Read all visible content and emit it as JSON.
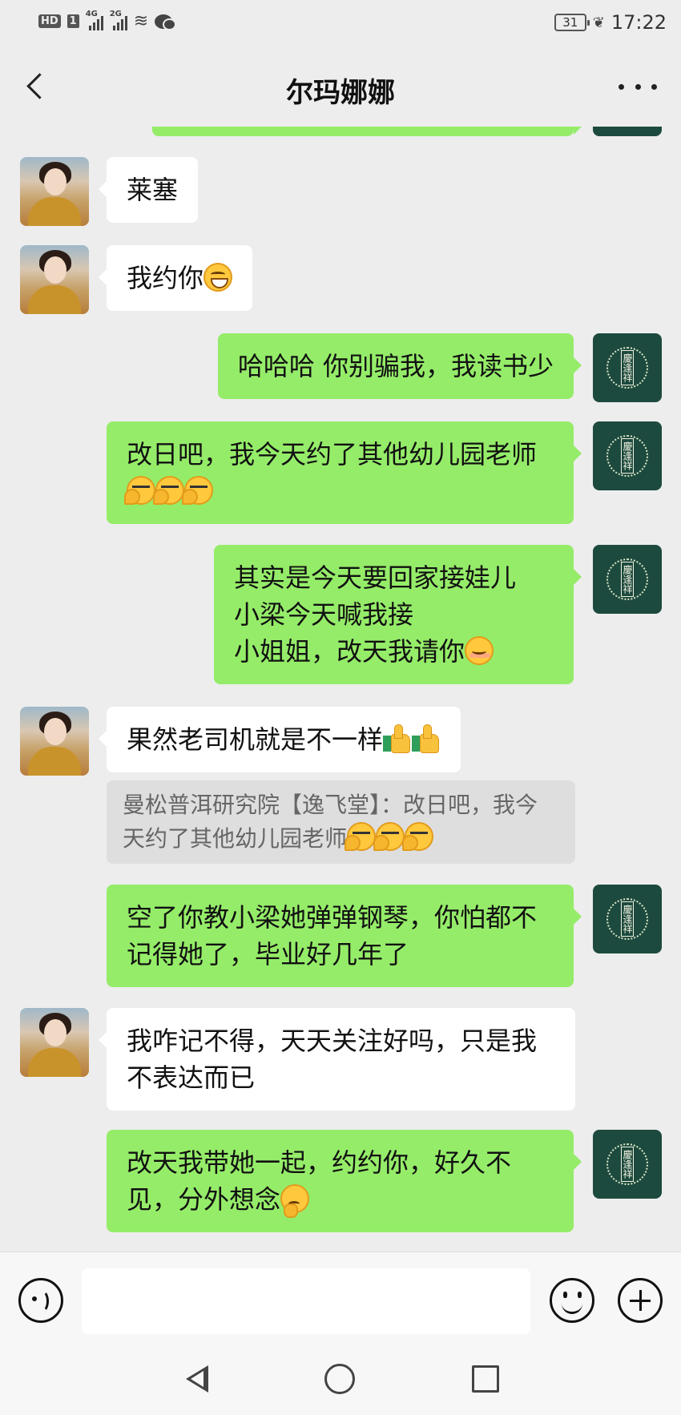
{
  "status_bar": {
    "hd": "HD",
    "sim": "1",
    "net1": "4G",
    "net2": "2G",
    "battery": "31",
    "time": "17:22"
  },
  "header": {
    "title": "尔玛娜娜"
  },
  "messages": [
    {
      "side": "in",
      "text": "莱塞"
    },
    {
      "side": "in",
      "text": "我约你",
      "emoji": [
        "grin"
      ]
    },
    {
      "side": "out",
      "text": "哈哈哈 你别骗我，我读书少"
    },
    {
      "side": "out",
      "text": "改日吧，我今天约了其他幼儿园老师",
      "emoji": [
        "smirk",
        "smirk",
        "smirk"
      ]
    },
    {
      "side": "out",
      "lines": [
        "其实是今天要回家接娃儿",
        "小梁今天喊我接",
        "小姐姐，改天我请你"
      ],
      "emoji": [
        "shy"
      ]
    },
    {
      "side": "in",
      "text": "果然老司机就是不一样",
      "emoji": [
        "thumbs-up",
        "thumbs-up"
      ]
    },
    {
      "side": "quote",
      "text": "曼松普洱研究院【逸飞堂】：改日吧，我今天约了其他幼儿园老师",
      "emoji": [
        "smirk",
        "smirk",
        "smirk"
      ]
    },
    {
      "side": "out",
      "text": "空了你教小梁她弹弹钢琴，你怕都不记得她了，毕业好几年了"
    },
    {
      "side": "in",
      "text": "我咋记不得，天天关注好吗，只是我不表达而已"
    },
    {
      "side": "out",
      "text": "改天我带她一起，约约你，好久不见，分外想念",
      "emoji": [
        "thinking"
      ]
    }
  ],
  "self_avatar_seal": "慶逢祥",
  "input": {
    "value": "",
    "placeholder": ""
  }
}
